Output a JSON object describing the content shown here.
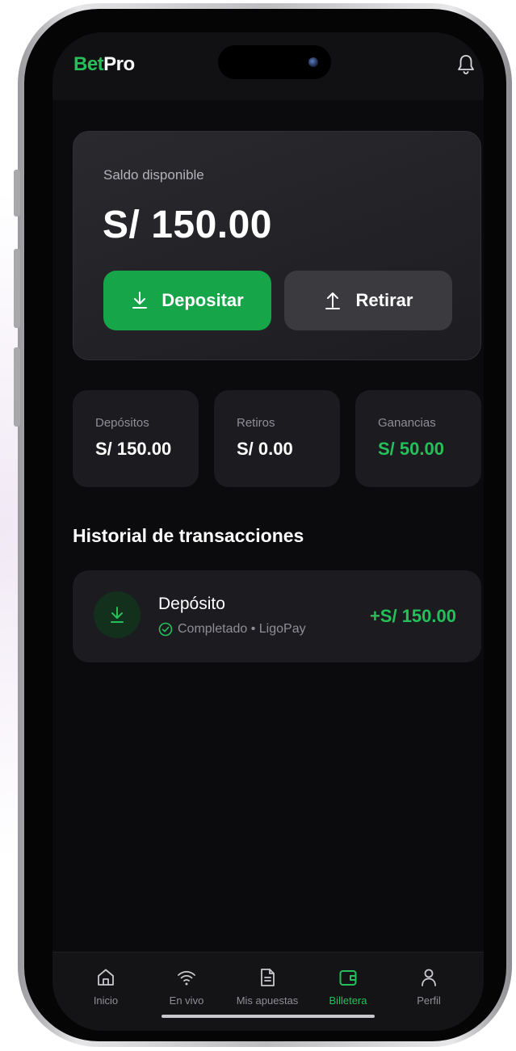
{
  "header": {
    "brand_part1": "Bet",
    "brand_part2": "Pro"
  },
  "balance": {
    "label": "Saldo disponible",
    "amount": "S/ 150.00",
    "deposit_label": "Depositar",
    "withdraw_label": "Retirar"
  },
  "stats": [
    {
      "label": "Depósitos",
      "value": "S/ 150.00"
    },
    {
      "label": "Retiros",
      "value": "S/ 0.00"
    },
    {
      "label": "Ganancias",
      "value": "S/ 50.00"
    }
  ],
  "history": {
    "title": "Historial de transacciones",
    "items": [
      {
        "title": "Depósito",
        "status": "Completado • LigoPay",
        "amount": "+S/ 150.00"
      }
    ]
  },
  "nav": [
    {
      "label": "Inicio",
      "icon": "home-icon"
    },
    {
      "label": "En vivo",
      "icon": "wifi-icon"
    },
    {
      "label": "Mis apuestas",
      "icon": "document-icon"
    },
    {
      "label": "Billetera",
      "icon": "wallet-icon"
    },
    {
      "label": "Perfil",
      "icon": "user-icon"
    }
  ],
  "colors": {
    "accent": "#25c05a",
    "deposit_button": "#17a54a",
    "background": "#0b0b0e"
  }
}
